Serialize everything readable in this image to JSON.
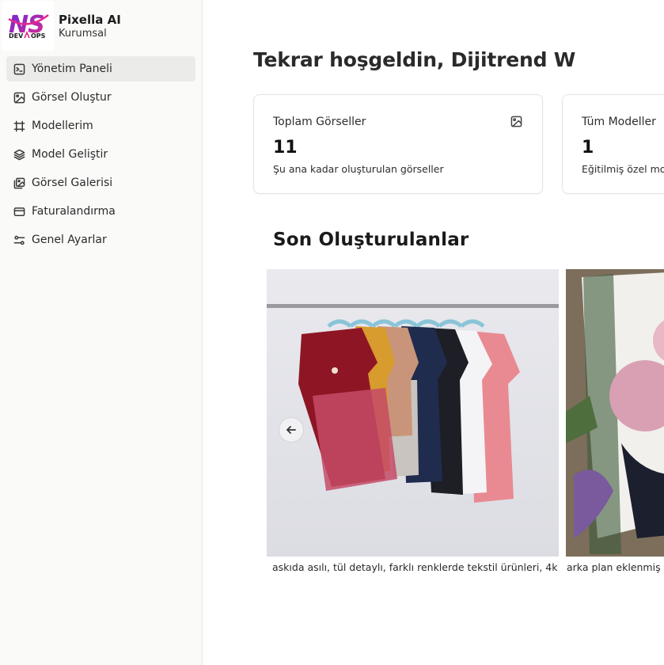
{
  "brand": {
    "name": "Pixella AI",
    "subtitle": "Kurumsal",
    "logo_text_top": "NS",
    "logo_text_bottom": "DEVOPS",
    "logo_icon": "ns-devops-logo"
  },
  "sidebar": {
    "items": [
      {
        "label": "Yönetim Paneli",
        "icon": "terminal-square-icon",
        "active": true
      },
      {
        "label": "Görsel Oluştur",
        "icon": "image-icon",
        "active": false
      },
      {
        "label": "Modellerim",
        "icon": "hash-icon",
        "active": false
      },
      {
        "label": "Model Geliştir",
        "icon": "layers-icon",
        "active": false
      },
      {
        "label": "Görsel Galerisi",
        "icon": "images-icon",
        "active": false
      },
      {
        "label": "Faturalandırma",
        "icon": "credit-card-icon",
        "active": false
      },
      {
        "label": "Genel Ayarlar",
        "icon": "settings-sliders-icon",
        "active": false
      }
    ]
  },
  "main": {
    "welcome": "Tekrar hoşgeldin, Dijitrend W",
    "stats": [
      {
        "title": "Toplam Görseller",
        "value": "11",
        "description": "Şu ana kadar oluşturulan görseller",
        "icon": "image-icon"
      },
      {
        "title": "Tüm Modeller",
        "value": "1",
        "description": "Eğitilmiş özel mod"
      }
    ],
    "recent_title": "Son Oluşturulanlar",
    "recent": [
      {
        "caption": "askıda asılı, tül detaylı, farklı renklerde tekstil ürünleri, 4k"
      },
      {
        "caption": "arka plan eklenmiş c"
      }
    ],
    "prev_icon": "arrow-left-icon"
  },
  "colors": {
    "sidebar_bg": "#fafaf9",
    "active_item_bg": "#ebebea",
    "logo_pink": "#e0298f",
    "logo_purple": "#6a2bd6"
  }
}
